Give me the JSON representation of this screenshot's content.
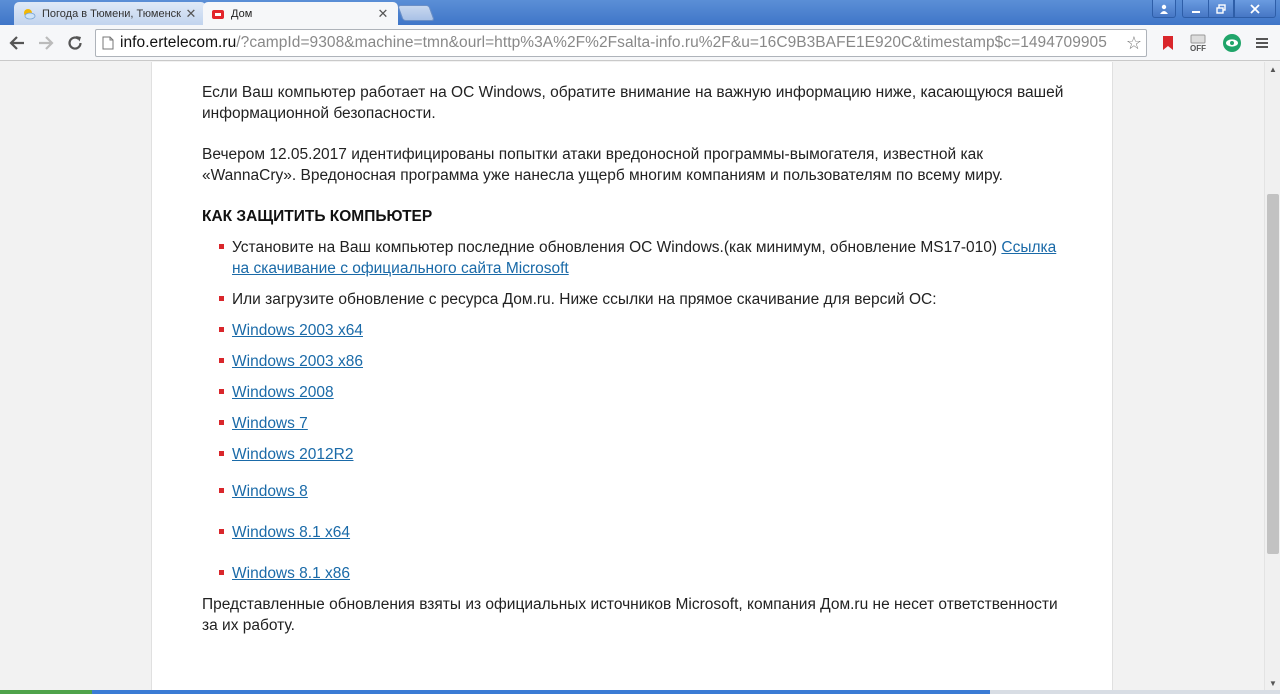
{
  "tabs": [
    {
      "title": "Погода в Тюмени, Тюменск",
      "active": false,
      "icon": "weather-icon"
    },
    {
      "title": "Дом",
      "active": true,
      "icon": "dom-ru-icon"
    }
  ],
  "toolbar": {
    "url_host": "info.ertelecom.ru",
    "url_rest": "/?campId=9308&machine=tmn&ourl=http%3A%2F%2Fsalta-info.ru%2F&u=16C9B3BAFE1E920C&timestamp$c=1494709905"
  },
  "page": {
    "intro1": "Если Ваш компьютер работает на ОС Windows, обратите внимание на важную информацию ниже, касающуюся вашей информационной безопасности.",
    "intro2": "Вечером 12.05.2017 идентифицированы попытки атаки вредоносной программы-вымогателя, известной как «WannaCry». Вредоносная программа уже нанесла ущерб многим компаниям и пользователям по всему миру.",
    "heading": "КАК ЗАЩИТИТЬ КОМПЬЮТЕР",
    "item1_text": "Установите на Ваш компьютер последние обновления ОС Windows.(как минимум, обновление MS17-010) ",
    "item1_link": "Ссылка на скачивание с официального сайта Microsoft",
    "item2_text": "Или загрузите обновление с ресурса Дом.ru. Ниже ссылки на прямое скачивание для версий ОС:",
    "links": [
      "Windows 2003 x64",
      "Windows 2003 x86",
      "Windows 2008",
      "Windows 7",
      "Windows 2012R2",
      "Windows 8",
      "Windows 8.1 x64",
      "Windows 8.1 x86"
    ],
    "footer": "Представленные обновления взяты из официальных источников Microsoft, компания Дом.ru не несет ответственности за их работу."
  },
  "colors": {
    "bullet": "#d9262b",
    "link": "#1a6aa8",
    "tabstrip": "#4a80cf"
  }
}
